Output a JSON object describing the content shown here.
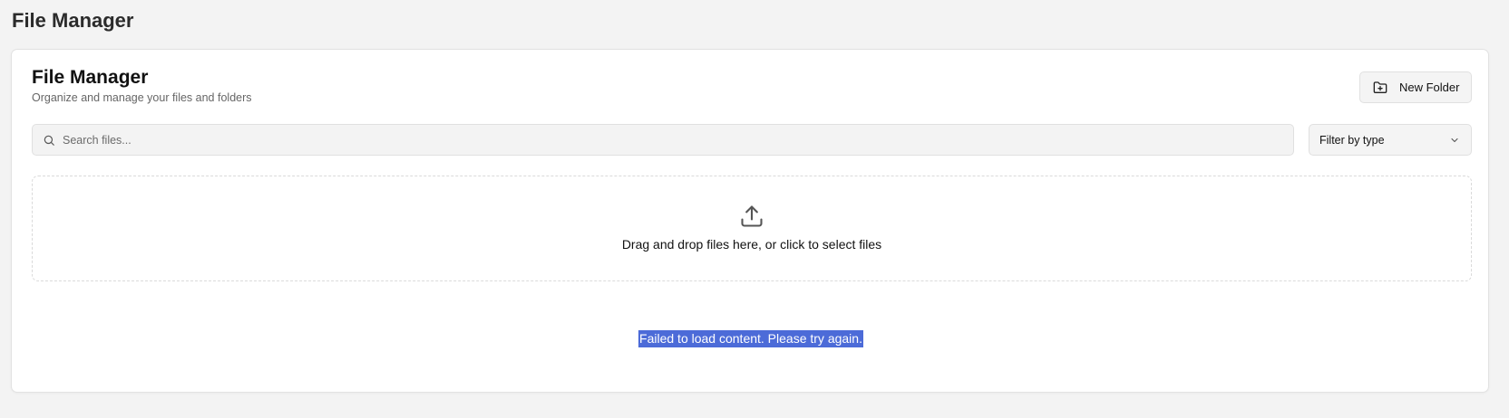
{
  "page": {
    "title": "File Manager"
  },
  "card": {
    "title": "File Manager",
    "subtitle": "Organize and manage your files and folders",
    "new_folder_label": "New Folder",
    "new_folder_icon": "folder-plus-icon"
  },
  "search": {
    "placeholder": "Search files...",
    "value": "",
    "icon": "search-icon"
  },
  "filter": {
    "selected": "Filter by type",
    "icon": "chevron-down-icon"
  },
  "dropzone": {
    "text": "Drag and drop files here, or click to select files",
    "icon": "upload-icon"
  },
  "error": {
    "message": "Failed to load content. Please try again.",
    "highlight_color": "#4c6bd8"
  }
}
